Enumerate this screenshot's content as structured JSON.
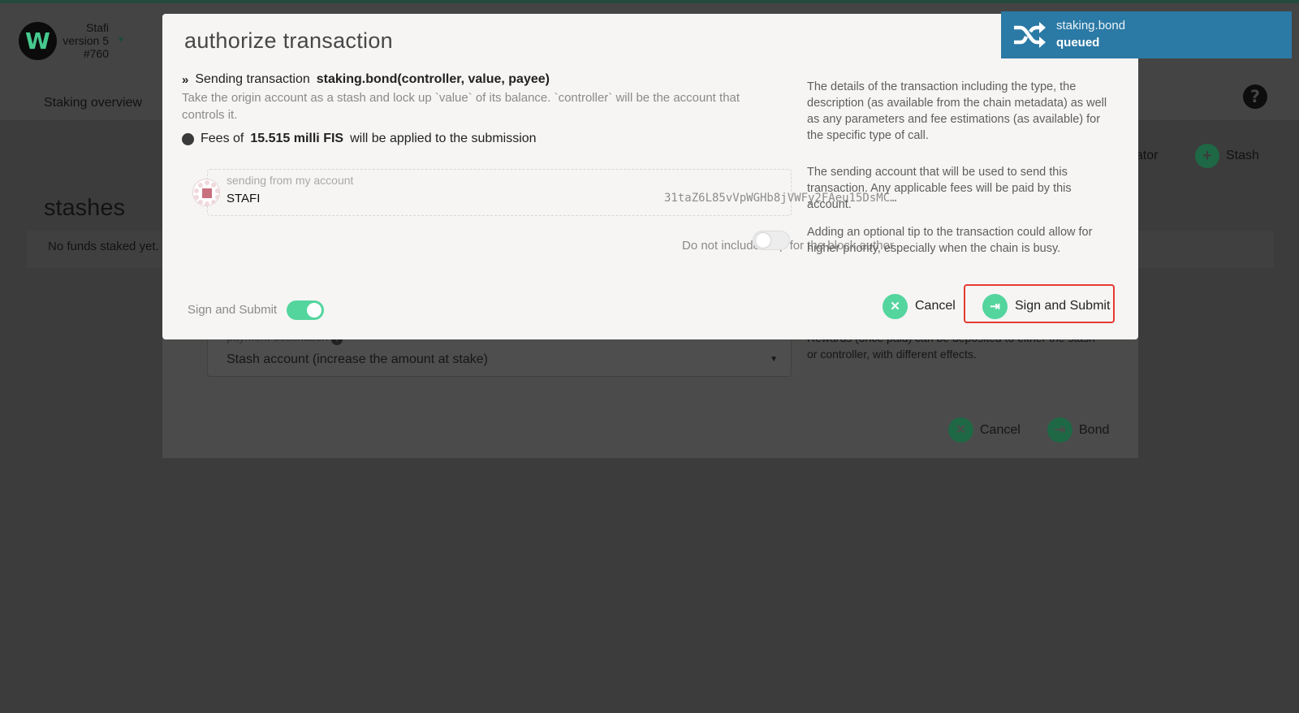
{
  "app": {
    "logo_glyph": "W",
    "chain_name": "Stafi",
    "chain_version": "version 5",
    "block_number": "#760",
    "tab_staking_overview": "Staking overview",
    "help_glyph": "?",
    "validator_partial": "dator",
    "add_stash_label": "Stash",
    "stashes_heading": "stashes",
    "no_funds_text": "No funds staked yet."
  },
  "bond_modal": {
    "payee_label": "payment destination",
    "payee_value": "Stash account (increase the amount at stake)",
    "payee_description": "Rewards (once paid) can be deposited to either the stash or controller, with different effects.",
    "cancel_label": "Cancel",
    "bond_label": "Bond"
  },
  "tx_modal": {
    "title": "authorize transaction",
    "sending_prefix": "Sending transaction",
    "call_signature": "staking.bond(controller, value, payee)",
    "call_description": "Take the origin account as a stash and lock up `value` of its balance. `controller` will be the account that controls it.",
    "fees_prefix": "Fees of",
    "fees_amount": "15.515 milli FIS",
    "fees_suffix": "will be applied to the submission",
    "account_label": "sending from my account",
    "account_name": "STAFI",
    "account_address": "31taZ6L85vVpWGHb8jVWFy2FAeu15DsMC…",
    "tip_label": "Do not include a tip for the block author",
    "tip_enabled": false,
    "help_details": "The details of the transaction including the type, the description (as available from the chain metadata) as well as any parameters and fee estimations (as available) for the specific type of call.",
    "help_account": "The sending account that will be used to send this transaction. Any applicable fees will be paid by this account.",
    "help_tip": "Adding an optional tip to the transaction could allow for higher priority, especially when the chain is busy.",
    "sign_toggle_label": "Sign and Submit",
    "sign_toggle_enabled": true,
    "cancel_label": "Cancel",
    "submit_label": "Sign and Submit"
  },
  "notification": {
    "method": "staking.bond",
    "status": "queued",
    "color": "#2b79a5"
  },
  "colors": {
    "accent": "#54d59e",
    "highlight": "#e53a2f",
    "overlay": "#3c3c3c"
  },
  "icons": {
    "logo": "polkadot-w-logo",
    "help": "question-circle-icon",
    "add": "plus-icon",
    "cancel": "x-icon",
    "submit": "sign-in-icon",
    "notification": "shuffle-icon",
    "tx": "double-chevron-icon"
  }
}
